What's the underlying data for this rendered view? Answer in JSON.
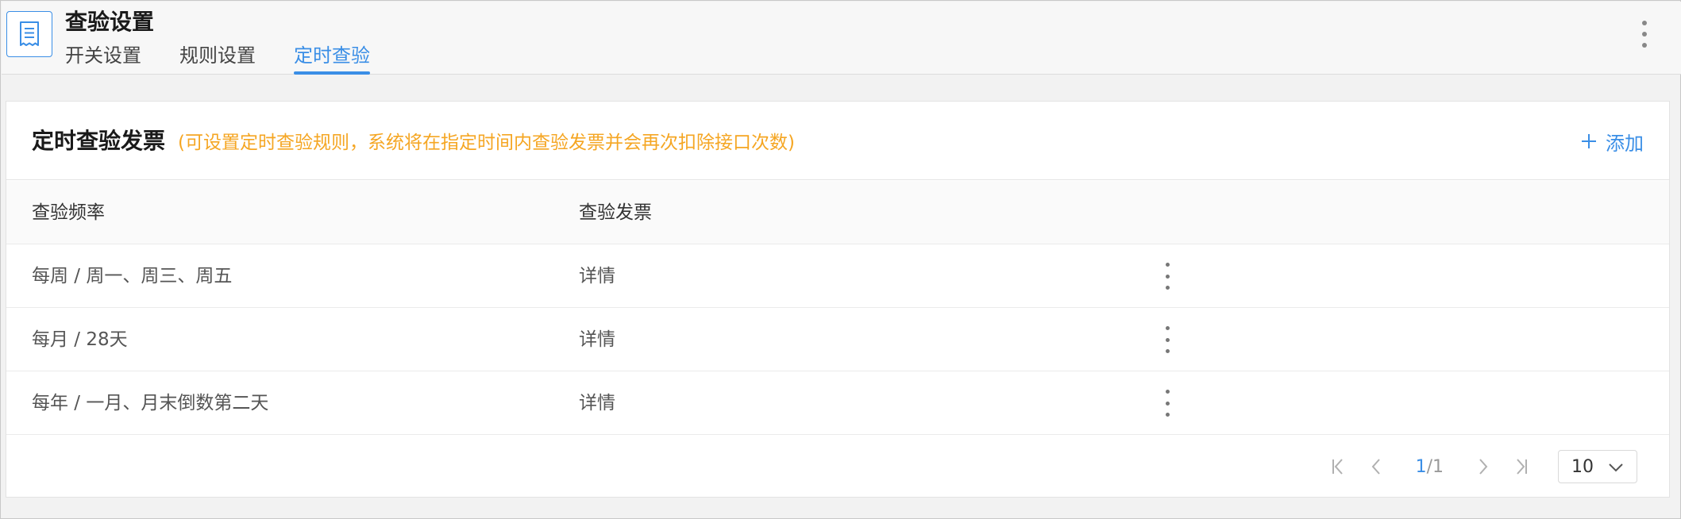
{
  "header": {
    "title": "查验设置",
    "tabs": [
      {
        "label": "开关设置",
        "active": false
      },
      {
        "label": "规则设置",
        "active": false
      },
      {
        "label": "定时查验",
        "active": true
      }
    ]
  },
  "card": {
    "title": "定时查验发票",
    "hint": "(可设置定时查验规则，系统将在指定时间内查验发票并会再次扣除接口次数)",
    "add_label": "添加"
  },
  "table": {
    "columns": [
      "查验频率",
      "查验发票"
    ],
    "rows": [
      {
        "frequency": "每周 / 周一、周三、周五",
        "invoice": "详情"
      },
      {
        "frequency": "每月 / 28天",
        "invoice": "详情"
      },
      {
        "frequency": "每年 / 一月、月末倒数第二天",
        "invoice": "详情"
      }
    ]
  },
  "pagination": {
    "current": "1",
    "total": "/1",
    "page_size": "10"
  },
  "colors": {
    "accent": "#3a8ee6",
    "hint": "#f5a623"
  },
  "icons": {
    "app": "receipt-icon",
    "more": "more-vertical-icon",
    "add": "plus-icon",
    "first": "first-page-icon",
    "prev": "chevron-left-icon",
    "next": "chevron-right-icon",
    "last": "last-page-icon",
    "dropdown": "chevron-down-icon"
  }
}
